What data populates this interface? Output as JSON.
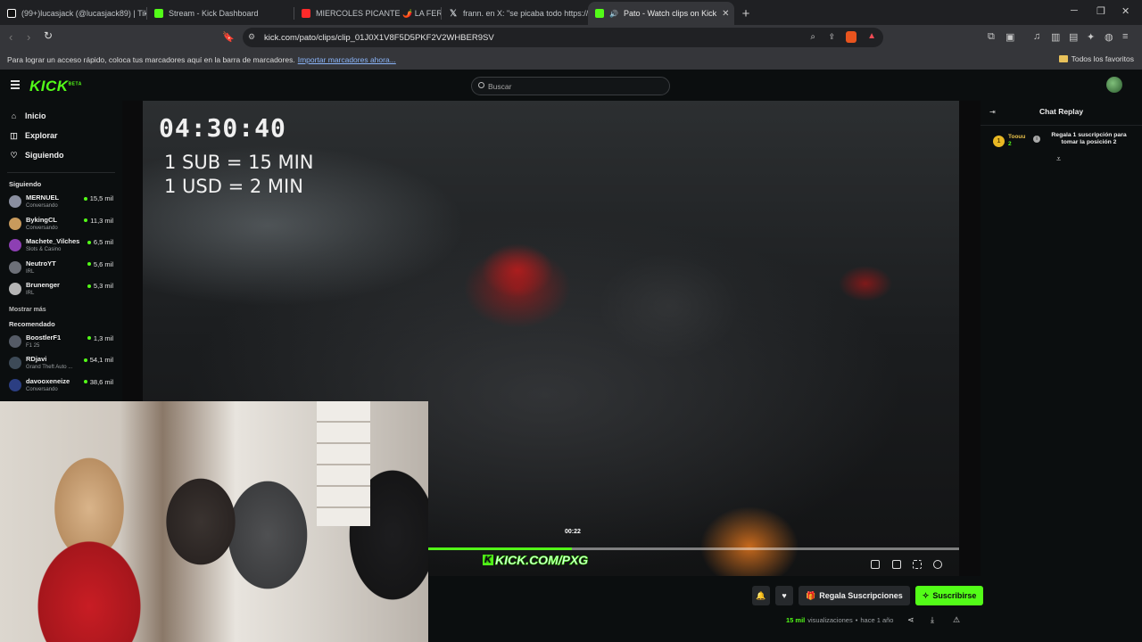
{
  "browser": {
    "tabs": [
      {
        "label": "(99+)lucasjack (@lucasjack89) | TikTo",
        "favicon_color": "#111111"
      },
      {
        "label": "Stream - Kick Dashboard",
        "favicon_color": "#53fc18"
      },
      {
        "label": "MIERCOLES PICANTE 🌶️ LA FERR",
        "favicon_color": "#ff2a2a"
      },
      {
        "label": "frann. en X: \"se picaba todo https://t.",
        "favicon_color": "#eeeeee"
      },
      {
        "label": "Pato - Watch clips on Kick",
        "favicon_color": "#53fc18",
        "active": true
      }
    ],
    "url": "kick.com/pato/clips/clip_01J0X1V8F5D5PKF2V2WHBER9SV",
    "bookmarks_hint": "Para lograr un acceso rápido, coloca tus marcadores aquí en la barra de marcadores.",
    "import_link": "Importar marcadores ahora...",
    "all_favorites": "Todos los favoritos"
  },
  "kick": {
    "logo": "KICK",
    "logo_badge": "BETA",
    "search_placeholder": "Buscar",
    "accent": "#53fc18"
  },
  "sidebar": {
    "nav": [
      {
        "label": "Inicio",
        "icon": "home-icon"
      },
      {
        "label": "Explorar",
        "icon": "compass-icon"
      },
      {
        "label": "Siguiendo",
        "icon": "heart-icon"
      }
    ],
    "following_heading": "Siguiendo",
    "following": [
      {
        "name": "MERNUEL",
        "category": "Conversando",
        "viewers": "15,5 mil",
        "avatar": "#8a8fa0"
      },
      {
        "name": "BykingCL",
        "category": "Conversando",
        "viewers": "11,3 mil",
        "avatar": "#c89a5c"
      },
      {
        "name": "Machete_Vilches",
        "category": "Slots & Casino",
        "viewers": "6,5 mil",
        "avatar": "#8d3fb3"
      },
      {
        "name": "NeutroYT",
        "category": "IRL",
        "viewers": "5,6 mil",
        "avatar": "#6d7078"
      },
      {
        "name": "Brunenger",
        "category": "IRL",
        "viewers": "5,3 mil",
        "avatar": "#b5b5b5"
      }
    ],
    "show_more": "Mostrar más",
    "recommended_heading": "Recomendado",
    "recommended": [
      {
        "name": "BoostlerF1",
        "category": "F1 25",
        "viewers": "1,3 mil",
        "avatar": "#555b66"
      },
      {
        "name": "RDjavi",
        "category": "Grand Theft Auto ...",
        "viewers": "54,1 mil",
        "avatar": "#3d4a57"
      },
      {
        "name": "davooxeneize",
        "category": "Conversando",
        "viewers": "38,6 mil",
        "avatar": "#2b3e82"
      }
    ]
  },
  "video": {
    "timer": "04:30:40",
    "rate_line_1": "1 SUB = 15 MIN",
    "rate_line_2": "1 USD = 2 MIN",
    "scrub_time": "00:22",
    "progress_fraction": 0.27,
    "watermark": "KICK.COM/PXG"
  },
  "chat": {
    "title": "Chat Replay",
    "gifter_name": "Toouu",
    "gifter_count": "2",
    "gifter_rank": "1",
    "gift_cta": "Regala 1 suscripción para tomar la posición 2"
  },
  "actions": {
    "gift_label": "Regala Suscripciones",
    "subscribe_label": "Suscribirse"
  },
  "meta": {
    "views": "15 mil",
    "views_suffix": "visualizaciones",
    "separator": "•",
    "age": "hace 1 año"
  }
}
